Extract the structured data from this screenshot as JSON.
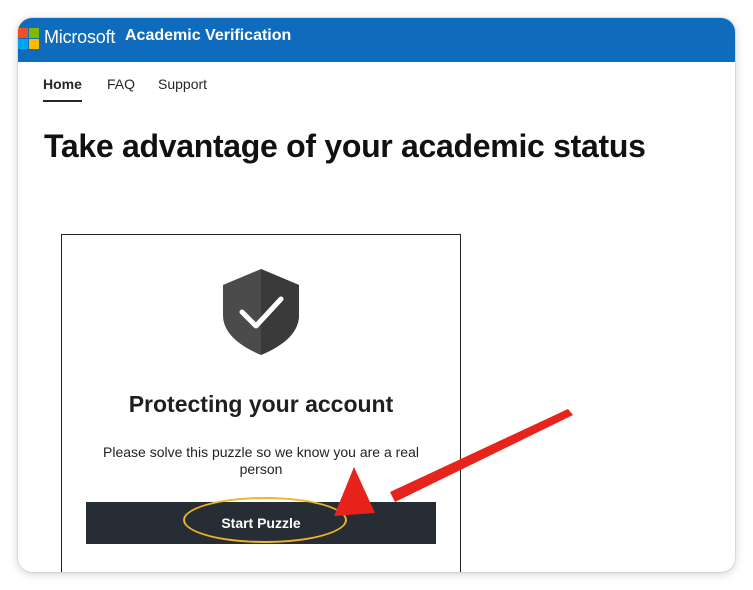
{
  "header": {
    "brand": "Microsoft",
    "site_title": "Academic Verification",
    "logo_colors": [
      "#f25022",
      "#7fba00",
      "#00a4ef",
      "#ffb900"
    ],
    "bar_color": "#0f6cbd"
  },
  "nav": {
    "items": [
      {
        "label": "Home",
        "active": true
      },
      {
        "label": "FAQ",
        "active": false
      },
      {
        "label": "Support",
        "active": false
      }
    ]
  },
  "main": {
    "title": "Take advantage of your academic status"
  },
  "captcha": {
    "icon": "shield-check-icon",
    "heading": "Protecting your account",
    "text": "Please solve this puzzle so we know you are a real person",
    "button_label": "Start Puzzle"
  },
  "annotation": {
    "arrow_color": "#e8231b",
    "ring_color": "#f0b429"
  }
}
